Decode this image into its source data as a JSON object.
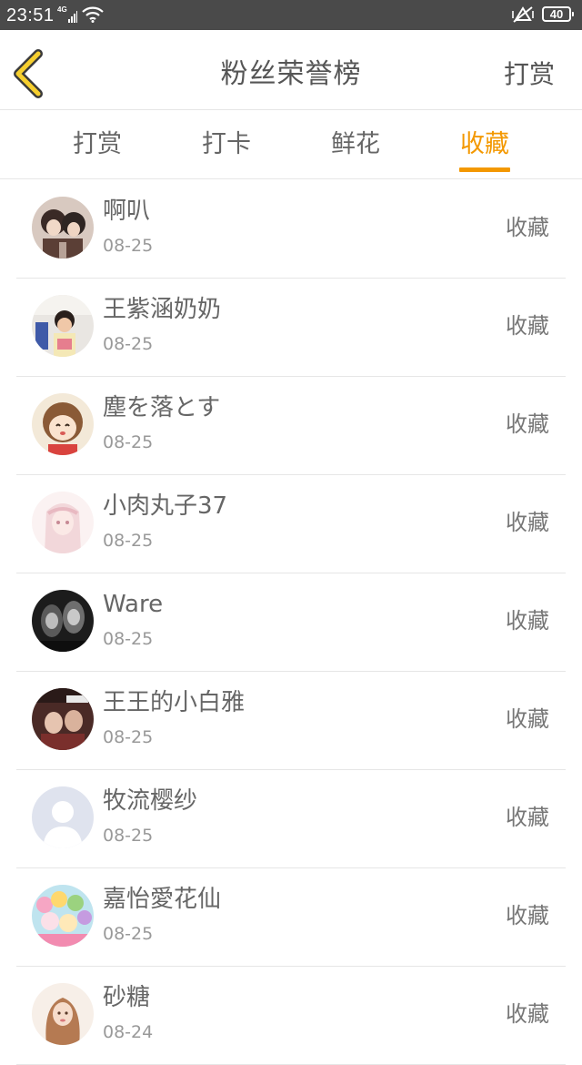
{
  "status_bar": {
    "time": "23:51",
    "network": "4G",
    "battery": "40"
  },
  "header": {
    "title": "粉丝荣誉榜",
    "action": "打赏",
    "accent_color": "#f39800"
  },
  "tabs": [
    {
      "label": "打赏",
      "active": false
    },
    {
      "label": "打卡",
      "active": false
    },
    {
      "label": "鲜花",
      "active": false
    },
    {
      "label": "收藏",
      "active": true
    }
  ],
  "fans": [
    {
      "name": "啊叭",
      "date": "08-25",
      "action": "收藏"
    },
    {
      "name": "王紫涵奶奶",
      "date": "08-25",
      "action": "收藏"
    },
    {
      "name": "塵を落とす",
      "date": "08-25",
      "action": "收藏"
    },
    {
      "name": "小肉丸子37",
      "date": "08-25",
      "action": "收藏"
    },
    {
      "name": "Ware",
      "date": "08-25",
      "action": "收藏"
    },
    {
      "name": "王王的小白雅",
      "date": "08-25",
      "action": "收藏"
    },
    {
      "name": "牧流樱纱",
      "date": "08-25",
      "action": "收藏"
    },
    {
      "name": "嘉怡愛花仙",
      "date": "08-25",
      "action": "收藏"
    },
    {
      "name": "砂糖",
      "date": "08-24",
      "action": "收藏"
    }
  ]
}
